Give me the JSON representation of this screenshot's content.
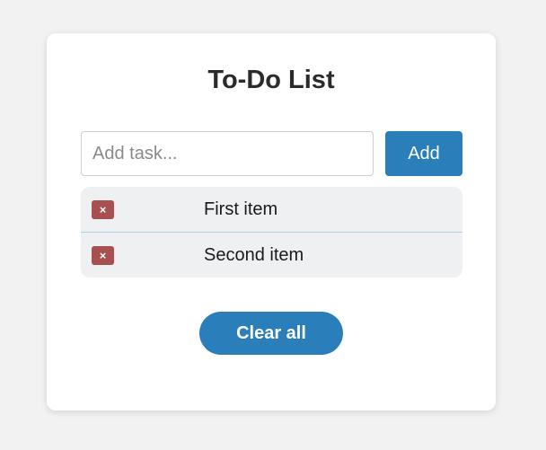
{
  "app": {
    "title": "To-Do List"
  },
  "form": {
    "input_value": "",
    "input_placeholder": "Add task...",
    "add_label": "Add"
  },
  "tasks": [
    {
      "text": "First item",
      "delete_glyph": "×",
      "delete_icon": "close-icon"
    },
    {
      "text": "Second item",
      "delete_glyph": "×",
      "delete_icon": "close-icon"
    }
  ],
  "actions": {
    "clear_label": "Clear all"
  },
  "colors": {
    "primary": "#2a7fba",
    "delete": "#a84f4f",
    "list_bg": "#eef0f2",
    "divider": "#a9d3e6"
  }
}
